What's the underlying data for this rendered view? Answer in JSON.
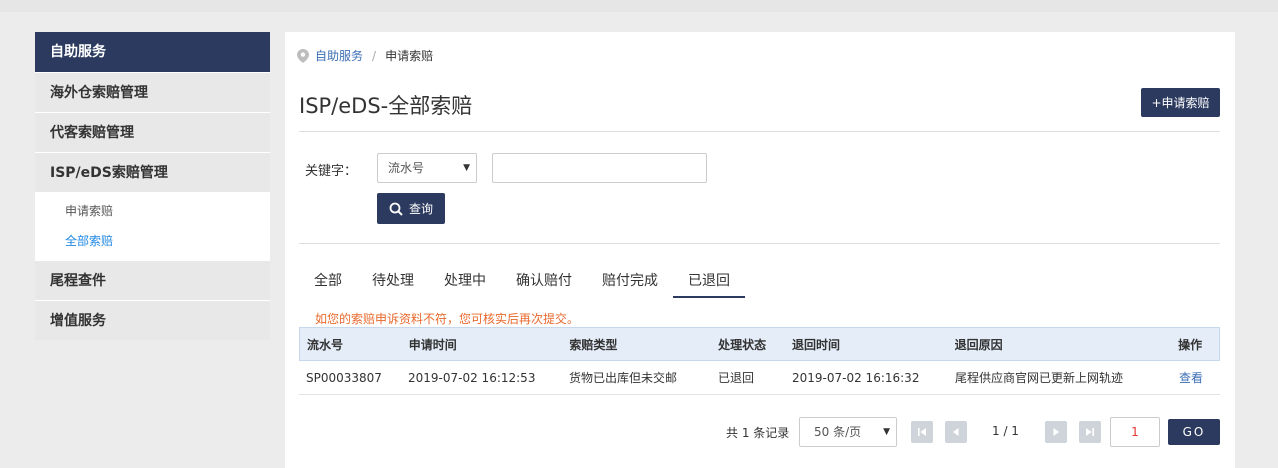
{
  "sidebar": {
    "header": "自助服务",
    "groups": [
      {
        "label": "海外仓索赔管理"
      },
      {
        "label": "代客索赔管理"
      },
      {
        "label": "ISP/eDS索赔管理"
      }
    ],
    "sub_items": [
      {
        "label": "申请索赔"
      },
      {
        "label": "全部索赔",
        "active": true
      }
    ],
    "groups_after": [
      {
        "label": "尾程查件"
      },
      {
        "label": "增值服务"
      }
    ]
  },
  "breadcrumb": {
    "parent": "自助服务",
    "separator": "/",
    "current": "申请索赔"
  },
  "page": {
    "title": "ISP/eDS-全部索赔",
    "apply_button": "+申请索赔"
  },
  "search": {
    "keyword_label": "关键字：",
    "field_select": "流水号",
    "keyword_value": "",
    "query_button": "查询"
  },
  "tabs": [
    {
      "label": "全部"
    },
    {
      "label": "待处理"
    },
    {
      "label": "处理中"
    },
    {
      "label": "确认赔付"
    },
    {
      "label": "赔付完成"
    },
    {
      "label": "已退回",
      "active": true
    }
  ],
  "notice": "如您的索赔申诉资料不符，您可核实后再次提交。",
  "table": {
    "columns": [
      "流水号",
      "申请时间",
      "索赔类型",
      "处理状态",
      "退回时间",
      "退回原因",
      "操作"
    ],
    "rows": [
      [
        "SP00033807",
        "2019-07-02 16:12:53",
        "货物已出库但未交邮",
        "已退回",
        "2019-07-02 16:16:32",
        "尾程供应商官网已更新上网轨迹",
        "查看"
      ]
    ]
  },
  "pagination": {
    "total_text": "共 1 条记录",
    "per_page": "50 条/页",
    "page_info": "1 / 1",
    "page_input": "1",
    "go_label": "GO"
  },
  "colors": {
    "primary": "#2b3a5e",
    "link": "#3c6fb4",
    "notice": "#e8692d",
    "table_header_bg": "#e4edf8"
  }
}
